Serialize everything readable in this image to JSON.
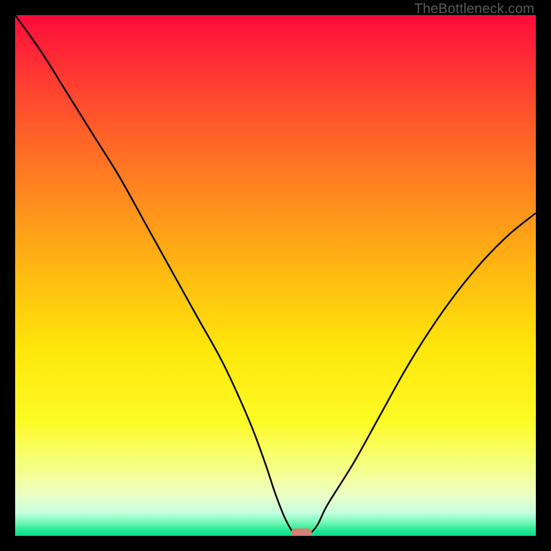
{
  "watermark": "TheBottleneck.com",
  "chart_data": {
    "type": "line",
    "title": "",
    "xlabel": "",
    "ylabel": "",
    "xlim": [
      0,
      100
    ],
    "ylim": [
      0,
      100
    ],
    "x": [
      0,
      5,
      10,
      15,
      20,
      25,
      30,
      35,
      40,
      45,
      48,
      50,
      52,
      54,
      56,
      58,
      60,
      65,
      70,
      75,
      80,
      85,
      90,
      95,
      100
    ],
    "values": [
      100,
      93,
      85,
      77,
      69,
      60,
      51,
      42,
      33,
      22,
      14,
      8,
      3,
      0,
      0,
      2,
      6,
      14,
      23,
      32,
      40,
      47,
      53,
      58,
      62
    ],
    "curve_minimum_x": 55,
    "marker": {
      "x": 55,
      "y": 0.5,
      "color": "#d58271"
    },
    "gradient_stops": [
      {
        "offset": 0.0,
        "color": "#ff0b3a"
      },
      {
        "offset": 0.12,
        "color": "#ff3a32"
      },
      {
        "offset": 0.3,
        "color": "#ff7a23"
      },
      {
        "offset": 0.48,
        "color": "#ffb512"
      },
      {
        "offset": 0.64,
        "color": "#ffe60a"
      },
      {
        "offset": 0.78,
        "color": "#fdfb25"
      },
      {
        "offset": 0.86,
        "color": "#f6ff7c"
      },
      {
        "offset": 0.92,
        "color": "#ecffc2"
      },
      {
        "offset": 0.955,
        "color": "#c7ffdf"
      },
      {
        "offset": 0.975,
        "color": "#71f7b7"
      },
      {
        "offset": 0.99,
        "color": "#20e892"
      },
      {
        "offset": 1.0,
        "color": "#06dd86"
      }
    ]
  }
}
